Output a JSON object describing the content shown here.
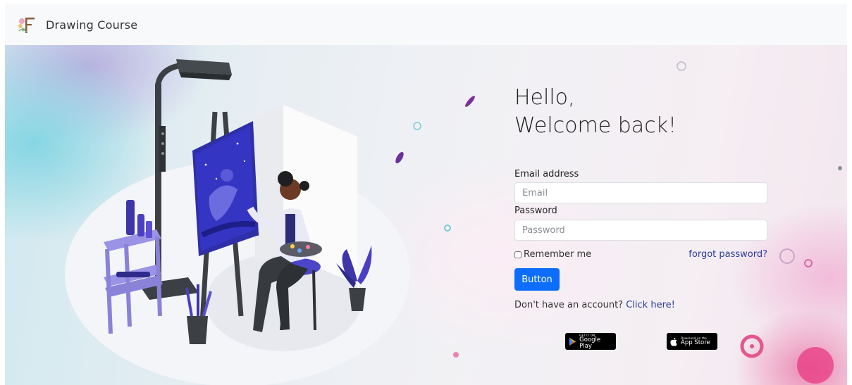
{
  "nav": {
    "brand": "Drawing Course"
  },
  "hero": {
    "greeting_line1": "Hello,",
    "greeting_line2": "Welcome back!"
  },
  "form": {
    "email_label": "Email address",
    "email_placeholder": "Email",
    "email_value": "",
    "password_label": "Password",
    "password_placeholder": "Password",
    "password_value": "",
    "remember_label": "Remember me",
    "remember_checked": false,
    "forgot_link": "forgot password?",
    "submit_label": "Button",
    "signup_prompt": "Don't have an account?",
    "signup_link": "Click here!"
  },
  "stores": {
    "google_small": "GET IT ON",
    "google_big": "Google Play",
    "apple_small": "Download on the",
    "apple_big": "App Store"
  },
  "colors": {
    "primary_button": "#0d6efd",
    "link": "#2a3e9c",
    "navbar_bg": "#f8f9fa"
  }
}
